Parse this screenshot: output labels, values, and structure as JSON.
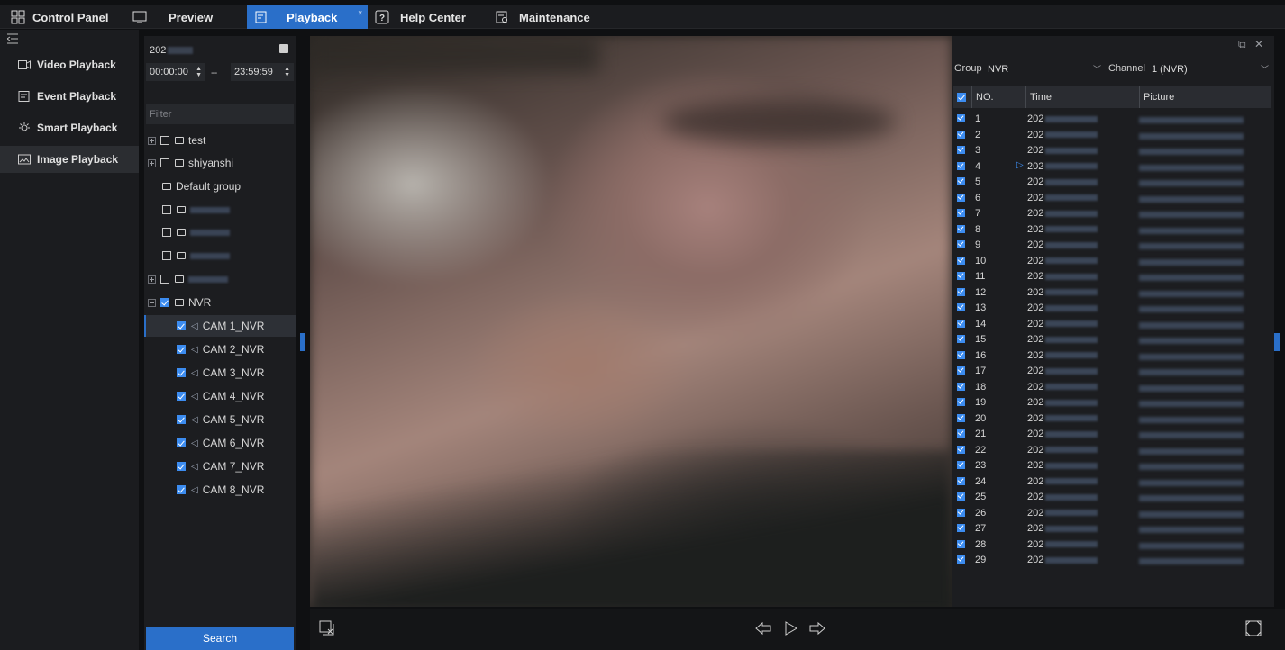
{
  "topnav": {
    "tabs": [
      {
        "label": "Control Panel",
        "icon": "grid-icon"
      },
      {
        "label": "Preview",
        "icon": "monitor-icon"
      },
      {
        "label": "Playback",
        "icon": "playback-icon",
        "active": true
      },
      {
        "label": "Help Center",
        "icon": "help-icon"
      },
      {
        "label": "Maintenance",
        "icon": "maintenance-icon"
      }
    ]
  },
  "sidebar": {
    "items": [
      {
        "label": "Video Playback",
        "icon": "video-icon"
      },
      {
        "label": "Event Playback",
        "icon": "event-icon"
      },
      {
        "label": "Smart Playback",
        "icon": "smart-bulb-icon"
      },
      {
        "label": "Image Playback",
        "icon": "image-icon",
        "active": true
      }
    ]
  },
  "search_panel": {
    "date_prefix": "202",
    "start_time": "00:00:00",
    "end_time": "23:59:59",
    "separator": "--",
    "filter_placeholder": "Filter",
    "search_label": "Search",
    "tree": [
      {
        "label": "test"
      },
      {
        "label": "shiyanshi"
      },
      {
        "label": "Default group"
      },
      {
        "label": ""
      },
      {
        "label": ""
      },
      {
        "label": ""
      },
      {
        "label": ""
      },
      {
        "label": "NVR"
      },
      {
        "label": "CAM 1_NVR"
      },
      {
        "label": "CAM 2_NVR"
      },
      {
        "label": "CAM 3_NVR"
      },
      {
        "label": "CAM 4_NVR"
      },
      {
        "label": "CAM 5_NVR"
      },
      {
        "label": "CAM 6_NVR"
      },
      {
        "label": "CAM 7_NVR"
      },
      {
        "label": "CAM 8_NVR"
      }
    ]
  },
  "list_panel": {
    "group_label": "Group",
    "group_value": "NVR",
    "channel_label": "Channel",
    "channel_value": "1 (NVR)",
    "columns": [
      "NO.",
      "Time",
      "Picture"
    ],
    "time_prefix": "202",
    "rows": [
      "1",
      "2",
      "3",
      "4",
      "5",
      "6",
      "7",
      "8",
      "9",
      "10",
      "11",
      "12",
      "13",
      "14",
      "15",
      "16",
      "17",
      "18",
      "19",
      "20",
      "21",
      "22",
      "23",
      "24",
      "25",
      "26",
      "27",
      "28",
      "29"
    ]
  },
  "colors": {
    "accent": "#2a6fc9",
    "checkbox": "#3c8cf0"
  }
}
